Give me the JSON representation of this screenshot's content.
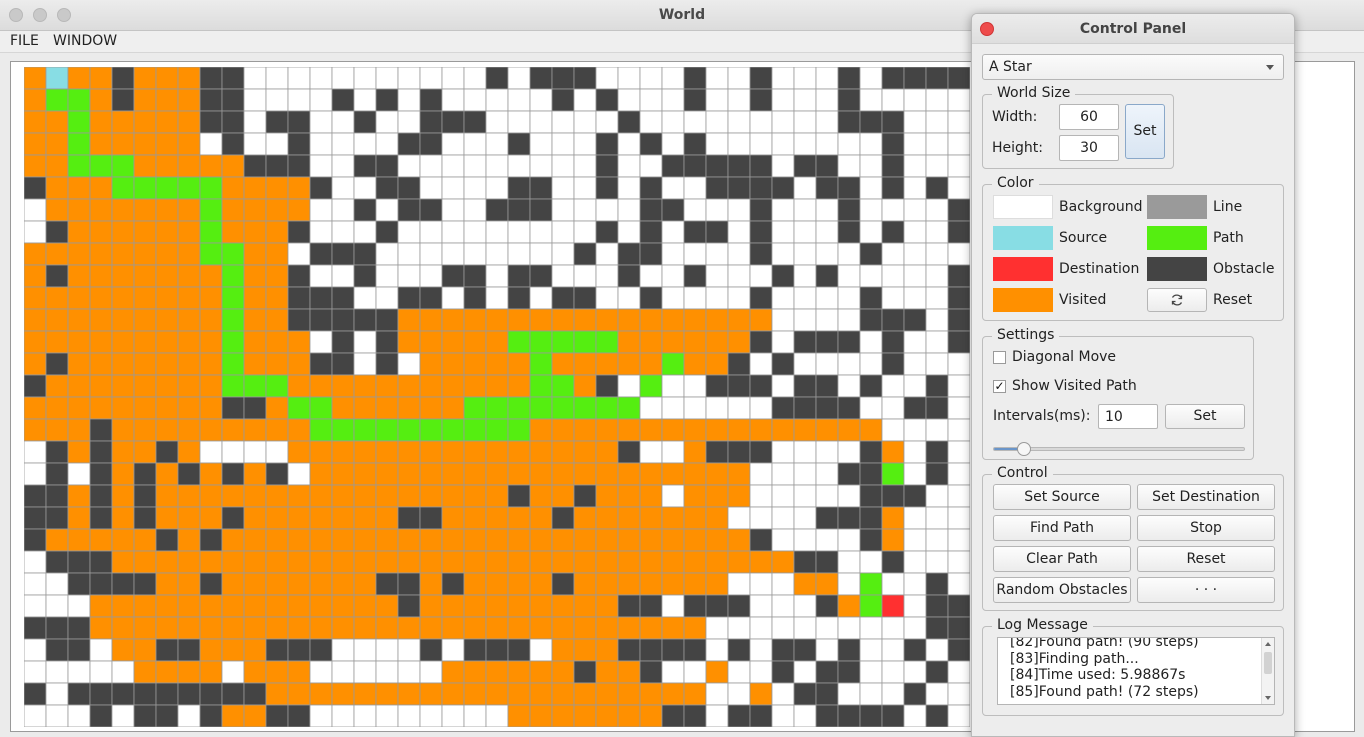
{
  "window": {
    "title": "World"
  },
  "menu": {
    "file": "FILE",
    "window": "WINDOW"
  },
  "grid": {
    "cols": 60,
    "rows": 30,
    "visible_cols": 43,
    "visible_rows": 30,
    "colors": {
      "0": "#ffffff",
      "1": "#444444",
      "2": "#ff9000",
      "3": "#55ee11",
      "4": "#88dde4",
      "5": "#ff3030"
    },
    "line_color": "#9a9a9a",
    "cells": [
      "2422122211000000000001011100001001000101111",
      "2332122211000010101000001010001001000100000",
      "2232222211011001001110000001000000000111000",
      "2232222201001000011000100010101000000001000",
      "2233322222111001100000000010011111011001000",
      "1222333332222100110000110010100111101101010",
      "0222222232222001011001110000110001000100001",
      "0122222232221000100000000010101101000101001",
      "2222222233220111000000000101100001000010000",
      "2122222223221001000110110001001000101000001",
      "2222222223221110011010101100100001000010001",
      "2222222223221111122222222222222222000011101",
      "2222222223222010122222333332222221011101001",
      "2122222223222110102222232222232210100001000",
      "1222222223332222222222233210300111011010010",
      "2222222221123322222233333333000000111100110",
      "2221222222222333333333322222222222222220000",
      "0121221200002222222222222221002111000012010",
      "0101212121210222222222222222222220000113010",
      "1121212222222222222222122122202220000011100",
      "1121212221222222211222221222222200001112000",
      "1222221212222222222222222222222221000012000",
      "0111222222222222222222222222222222211001000",
      "0011112212222222112122221222222200022030010",
      "0002222222222222212222222221101110001235011",
      "1112222222222222222222222222222000000000011",
      "0110221122211100001011102221111010110100101",
      "0000022220222000000222222122100200101100010",
      "1011111111122222222222222222222002011000100",
      "0001011012211000000000222222211011001111010"
    ]
  },
  "panel": {
    "title": "Control Panel",
    "algorithm": "A Star",
    "world_size": {
      "title": "World Size",
      "width_label": "Width:",
      "width_value": "60",
      "height_label": "Height:",
      "height_value": "30",
      "set_label": "Set"
    },
    "color": {
      "title": "Color",
      "background_label": "Background",
      "background_color": "#ffffff",
      "line_label": "Line",
      "line_color": "#9a9a9a",
      "source_label": "Source",
      "source_color": "#88dde4",
      "path_label": "Path",
      "path_color": "#55ee11",
      "destination_label": "Destination",
      "destination_color": "#ff3030",
      "obstacle_label": "Obstacle",
      "obstacle_color": "#444444",
      "visited_label": "Visited",
      "visited_color": "#ff9000",
      "reset_label": "Reset"
    },
    "settings": {
      "title": "Settings",
      "diagonal_label": "Diagonal Move",
      "diagonal_checked": false,
      "show_visited_label": "Show Visited Path",
      "show_visited_checked": true,
      "intervals_label": "Intervals(ms):",
      "intervals_value": "10",
      "set_label": "Set",
      "slider_level": 0.12
    },
    "control": {
      "title": "Control",
      "set_source": "Set Source",
      "set_destination": "Set Destination",
      "find_path": "Find Path",
      "stop": "Stop",
      "clear_path": "Clear Path",
      "reset": "Reset",
      "random_obstacles": "Random Obstacles",
      "more": "· · ·"
    },
    "log": {
      "title": "Log Message",
      "lines": [
        "[82]Found path! (90 steps)",
        "[83]Finding path...",
        "[84]Time used: 5.98867s",
        "[85]Found path! (72 steps)"
      ]
    }
  }
}
